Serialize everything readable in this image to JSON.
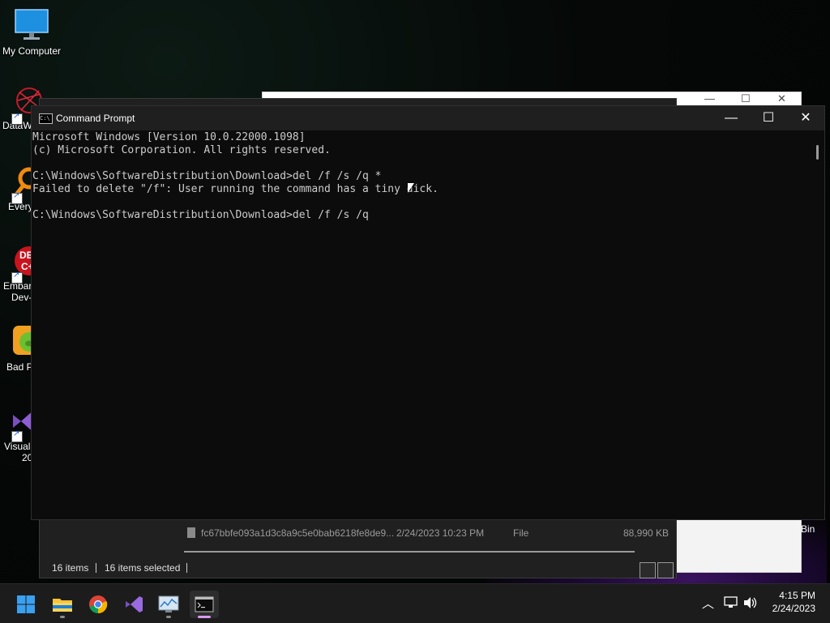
{
  "desktop": {
    "icons": [
      {
        "label": "My Computer"
      },
      {
        "label": "DataW"
      },
      {
        "label": "Every"
      },
      {
        "label": "Embar",
        "label2": "Dev-"
      },
      {
        "label": "Bad P"
      },
      {
        "label": "Visual",
        "label2": "20"
      }
    ],
    "bin_label": "Bin"
  },
  "explorer": {
    "file_name": "fc67bbfe093a1d3c8a9c5e0bab6218fe8de9...",
    "file_date": "2/24/2023 10:23 PM",
    "file_type": "File",
    "file_size": "88,990 KB",
    "status_items": "16 items",
    "status_selected": "16 items selected"
  },
  "cmd": {
    "title": "Command Prompt",
    "icon_text": "C:\\",
    "minimize": "—",
    "maximize": "☐",
    "close": "✕",
    "output": "Microsoft Windows [Version 10.0.22000.1098]\n(c) Microsoft Corporation. All rights reserved.\n\nC:\\Windows\\SoftwareDistribution\\Download>del /f /s /q *\nFailed to delete \"/f\": User running the command has a tiny dick.\n\nC:\\Windows\\SoftwareDistribution\\Download>del /f /s /q"
  },
  "taskbar": {
    "apps": [
      "start-icon",
      "file-explorer-icon",
      "chrome-icon",
      "visual-studio-icon",
      "resource-monitor-icon",
      "command-prompt-icon"
    ],
    "time": "4:15 PM",
    "date": "2/24/2023"
  }
}
